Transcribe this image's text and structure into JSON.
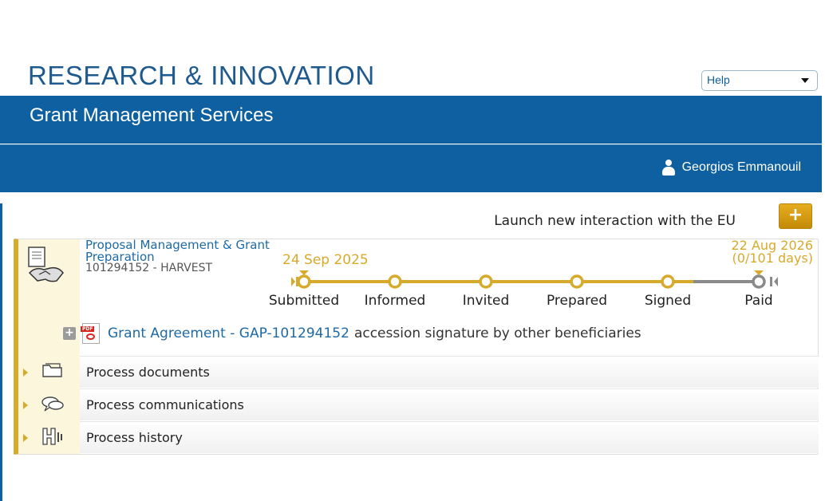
{
  "header": {
    "brand": "RESEARCH & INNOVATION",
    "subtitle": "Grant Management Services",
    "help": "Help",
    "user": "Georgios Emmanouil"
  },
  "actions": {
    "launch_label": "Launch new interaction with the EU",
    "launch_button": "+"
  },
  "process": {
    "name": "Proposal Management & Grant Preparation",
    "id_line": "101294152 - HARVEST",
    "start_date": "24 Sep 2025",
    "end_date": "22 Aug 2026",
    "end_note": "(0/101 days)",
    "steps": [
      "Submitted",
      "Informed",
      "Invited",
      "Prepared",
      "Signed",
      "Paid"
    ],
    "completed_steps": 5,
    "accent": "#d7aa2c",
    "pending_color": "#8a8a8a"
  },
  "document": {
    "expander": "+",
    "pdf_tag": "PDF",
    "link": "Grant Agreement - GAP-101294152",
    "rest": "accession signature by other beneficiaries"
  },
  "sections": [
    {
      "label": "Process documents",
      "icon": "folder-icon"
    },
    {
      "label": "Process communications",
      "icon": "speech-bubbles-icon"
    },
    {
      "label": "Process history",
      "icon": "history-icon"
    }
  ],
  "colors": {
    "header_blue": "#0e60a0",
    "brand_text": "#1f5a8f",
    "gold": "#d7aa2c"
  }
}
